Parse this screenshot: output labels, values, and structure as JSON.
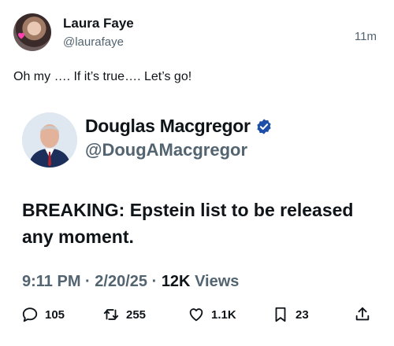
{
  "post": {
    "author_name": "Laura Faye",
    "author_handle": "@laurafaye",
    "timestamp": "11m",
    "text": "Oh my …. If it’s true…. Let’s go!",
    "avatar_icon": "profile-photo"
  },
  "quoted_post": {
    "author_name": "Douglas Macgregor",
    "author_handle": "@DougAMacgregor",
    "verified": true,
    "verified_color": "#1d4ea8",
    "text": "BREAKING: Epstein list to be released any moment.",
    "time": "9:11 PM",
    "date": "2/20/25",
    "separator": "·",
    "views_count": "12K",
    "views_label": "Views"
  },
  "actions": {
    "reply_count": "105",
    "retweet_count": "255",
    "like_count": "1.1K",
    "bookmark_count": "23"
  },
  "colors": {
    "text_primary": "#0f1419",
    "text_secondary": "#536471",
    "background": "#ffffff"
  }
}
